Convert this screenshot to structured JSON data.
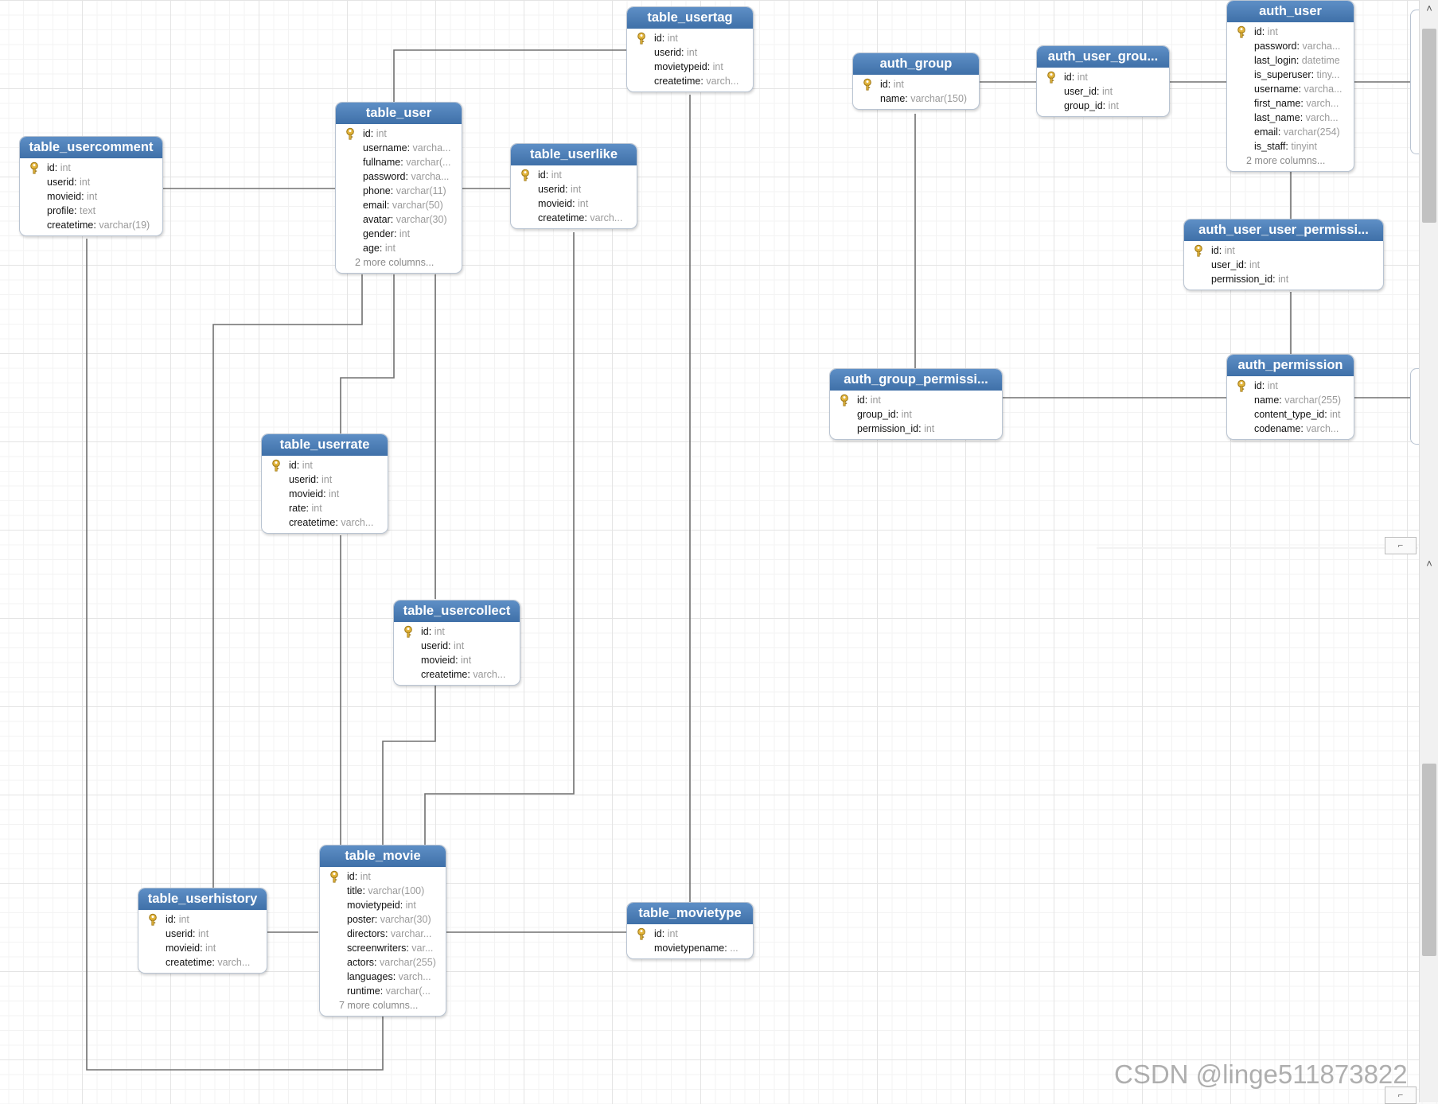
{
  "entities": {
    "table_usertag": {
      "title": "table_usertag",
      "fields": [
        {
          "name": "id",
          "type": "int",
          "pk": true
        },
        {
          "name": "userid",
          "type": "int",
          "pk": false
        },
        {
          "name": "movietypeid",
          "type": "int",
          "pk": false
        },
        {
          "name": "createtime",
          "type": "varch...",
          "pk": false
        }
      ],
      "more": ""
    },
    "table_user": {
      "title": "table_user",
      "fields": [
        {
          "name": "id",
          "type": "int",
          "pk": true
        },
        {
          "name": "username",
          "type": "varcha...",
          "pk": false
        },
        {
          "name": "fullname",
          "type": "varchar(...",
          "pk": false
        },
        {
          "name": "password",
          "type": "varcha...",
          "pk": false
        },
        {
          "name": "phone",
          "type": "varchar(11)",
          "pk": false
        },
        {
          "name": "email",
          "type": "varchar(50)",
          "pk": false
        },
        {
          "name": "avatar",
          "type": "varchar(30)",
          "pk": false
        },
        {
          "name": "gender",
          "type": "int",
          "pk": false
        },
        {
          "name": "age",
          "type": "int",
          "pk": false
        }
      ],
      "more": "2 more columns..."
    },
    "table_usercomment": {
      "title": "table_usercomment",
      "fields": [
        {
          "name": "id",
          "type": "int",
          "pk": true
        },
        {
          "name": "userid",
          "type": "int",
          "pk": false
        },
        {
          "name": "movieid",
          "type": "int",
          "pk": false
        },
        {
          "name": "profile",
          "type": "text",
          "pk": false
        },
        {
          "name": "createtime",
          "type": "varchar(19)",
          "pk": false
        }
      ],
      "more": ""
    },
    "table_userlike": {
      "title": "table_userlike",
      "fields": [
        {
          "name": "id",
          "type": "int",
          "pk": true
        },
        {
          "name": "userid",
          "type": "int",
          "pk": false
        },
        {
          "name": "movieid",
          "type": "int",
          "pk": false
        },
        {
          "name": "createtime",
          "type": "varch...",
          "pk": false
        }
      ],
      "more": ""
    },
    "table_userrate": {
      "title": "table_userrate",
      "fields": [
        {
          "name": "id",
          "type": "int",
          "pk": true
        },
        {
          "name": "userid",
          "type": "int",
          "pk": false
        },
        {
          "name": "movieid",
          "type": "int",
          "pk": false
        },
        {
          "name": "rate",
          "type": "int",
          "pk": false
        },
        {
          "name": "createtime",
          "type": "varch...",
          "pk": false
        }
      ],
      "more": ""
    },
    "table_usercollect": {
      "title": "table_usercollect",
      "fields": [
        {
          "name": "id",
          "type": "int",
          "pk": true
        },
        {
          "name": "userid",
          "type": "int",
          "pk": false
        },
        {
          "name": "movieid",
          "type": "int",
          "pk": false
        },
        {
          "name": "createtime",
          "type": "varch...",
          "pk": false
        }
      ],
      "more": ""
    },
    "table_movie": {
      "title": "table_movie",
      "fields": [
        {
          "name": "id",
          "type": "int",
          "pk": true
        },
        {
          "name": "title",
          "type": "varchar(100)",
          "pk": false
        },
        {
          "name": "movietypeid",
          "type": "int",
          "pk": false
        },
        {
          "name": "poster",
          "type": "varchar(30)",
          "pk": false
        },
        {
          "name": "directors",
          "type": "varchar...",
          "pk": false
        },
        {
          "name": "screenwriters",
          "type": "var...",
          "pk": false
        },
        {
          "name": "actors",
          "type": "varchar(255)",
          "pk": false
        },
        {
          "name": "languages",
          "type": "varch...",
          "pk": false
        },
        {
          "name": "runtime",
          "type": "varchar(...",
          "pk": false
        }
      ],
      "more": "7 more columns..."
    },
    "table_userhistory": {
      "title": "table_userhistory",
      "fields": [
        {
          "name": "id",
          "type": "int",
          "pk": true
        },
        {
          "name": "userid",
          "type": "int",
          "pk": false
        },
        {
          "name": "movieid",
          "type": "int",
          "pk": false
        },
        {
          "name": "createtime",
          "type": "varch...",
          "pk": false
        }
      ],
      "more": ""
    },
    "table_movietype": {
      "title": "table_movietype",
      "fields": [
        {
          "name": "id",
          "type": "int",
          "pk": true
        },
        {
          "name": "movietypename",
          "type": "...",
          "pk": false
        }
      ],
      "more": ""
    },
    "auth_group": {
      "title": "auth_group",
      "fields": [
        {
          "name": "id",
          "type": "int",
          "pk": true
        },
        {
          "name": "name",
          "type": "varchar(150)",
          "pk": false
        }
      ],
      "more": ""
    },
    "auth_user_groups": {
      "title": "auth_user_grou...",
      "fields": [
        {
          "name": "id",
          "type": "int",
          "pk": true
        },
        {
          "name": "user_id",
          "type": "int",
          "pk": false
        },
        {
          "name": "group_id",
          "type": "int",
          "pk": false
        }
      ],
      "more": ""
    },
    "auth_user": {
      "title": "auth_user",
      "fields": [
        {
          "name": "id",
          "type": "int",
          "pk": true
        },
        {
          "name": "password",
          "type": "varcha...",
          "pk": false
        },
        {
          "name": "last_login",
          "type": "datetime",
          "pk": false
        },
        {
          "name": "is_superuser",
          "type": "tiny...",
          "pk": false
        },
        {
          "name": "username",
          "type": "varcha...",
          "pk": false
        },
        {
          "name": "first_name",
          "type": "varch...",
          "pk": false
        },
        {
          "name": "last_name",
          "type": "varch...",
          "pk": false
        },
        {
          "name": "email",
          "type": "varchar(254)",
          "pk": false
        },
        {
          "name": "is_staff",
          "type": "tinyint",
          "pk": false
        }
      ],
      "more": "2 more columns..."
    },
    "auth_user_user_permissions": {
      "title": "auth_user_user_permissi...",
      "fields": [
        {
          "name": "id",
          "type": "int",
          "pk": true
        },
        {
          "name": "user_id",
          "type": "int",
          "pk": false
        },
        {
          "name": "permission_id",
          "type": "int",
          "pk": false
        }
      ],
      "more": ""
    },
    "auth_group_permissions": {
      "title": "auth_group_permissi...",
      "fields": [
        {
          "name": "id",
          "type": "int",
          "pk": true
        },
        {
          "name": "group_id",
          "type": "int",
          "pk": false
        },
        {
          "name": "permission_id",
          "type": "int",
          "pk": false
        }
      ],
      "more": ""
    },
    "auth_permission": {
      "title": "auth_permission",
      "fields": [
        {
          "name": "id",
          "type": "int",
          "pk": true
        },
        {
          "name": "name",
          "type": "varchar(255)",
          "pk": false
        },
        {
          "name": "content_type_id",
          "type": "int",
          "pk": false
        },
        {
          "name": "codename",
          "type": "varch...",
          "pk": false
        }
      ],
      "more": ""
    }
  },
  "relationships": [
    {
      "from": "table_user",
      "to": "table_usertag"
    },
    {
      "from": "table_user",
      "to": "table_usercomment"
    },
    {
      "from": "table_user",
      "to": "table_userlike"
    },
    {
      "from": "table_user",
      "to": "table_userhistory"
    },
    {
      "from": "table_user",
      "to": "table_userrate"
    },
    {
      "from": "table_user",
      "to": "table_usercollect"
    },
    {
      "from": "table_movie",
      "to": "table_usercomment"
    },
    {
      "from": "table_movie",
      "to": "table_userhistory"
    },
    {
      "from": "table_movie",
      "to": "table_userrate"
    },
    {
      "from": "table_movie",
      "to": "table_usercollect"
    },
    {
      "from": "table_movie",
      "to": "table_userlike"
    },
    {
      "from": "table_movie",
      "to": "table_movietype"
    },
    {
      "from": "table_movietype",
      "to": "table_usertag"
    },
    {
      "from": "auth_group",
      "to": "auth_user_groups"
    },
    {
      "from": "auth_user",
      "to": "auth_user_groups"
    },
    {
      "from": "auth_group",
      "to": "auth_group_permissions"
    },
    {
      "from": "auth_permission",
      "to": "auth_group_permissions"
    },
    {
      "from": "auth_user",
      "to": "auth_user_user_permissions"
    },
    {
      "from": "auth_permission",
      "to": "auth_user_user_permissions"
    }
  ],
  "watermark": "CSDN @linge511873822",
  "icons": {
    "primary_key": "key-icon",
    "scroll_up": "chevron-up-icon"
  },
  "colors": {
    "header_top": "#5e8fc6",
    "header_bottom": "#3f70a8",
    "key_gold": "#e0b43a",
    "line": "#707070"
  }
}
